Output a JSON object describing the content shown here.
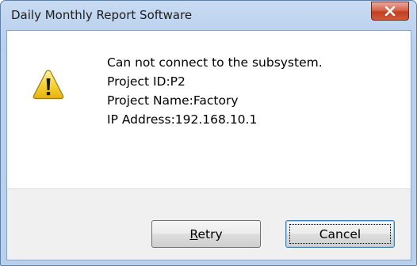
{
  "window": {
    "title": "Daily Monthly Report Software"
  },
  "icons": {
    "warning": "warning-triangle-icon",
    "close": "close-icon"
  },
  "message": {
    "lines": [
      "Can not connect to the subsystem.",
      "Project ID:P2",
      "Project Name:Factory",
      "IP Address:192.168.10.1"
    ]
  },
  "buttons": {
    "retry": {
      "mnemonic": "R",
      "rest": "etry"
    },
    "cancel": {
      "label": "Cancel"
    }
  },
  "colors": {
    "titlebar": "#c8dbf2",
    "close_button": "#c13e21",
    "button_panel": "#f0f0f0",
    "warning_fill": "#f7d433"
  }
}
